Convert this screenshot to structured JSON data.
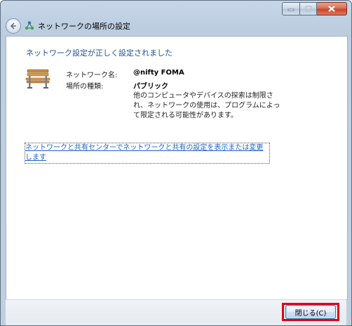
{
  "window": {
    "title": "ネットワークの場所の設定",
    "icons": {
      "back": "back-arrow-icon",
      "network": "network-icon",
      "minimize": "minimize-icon",
      "maximize": "maximize-icon",
      "close": "close-icon"
    }
  },
  "main": {
    "heading": "ネットワーク設定が正しく設定されました",
    "network_name_label": "ネットワーク名:",
    "network_name_value": "@nifty FOMA",
    "location_type_label": "場所の種類:",
    "location_type_value": "パブリック",
    "description": "他のコンピュータやデバイスの探索は制限され、ネットワークの使用は、プログラムによって限定される可能性があります。",
    "link_text": "ネットワークと共有センターでネットワークと共有の設定を表示または変更します",
    "icon": "park-bench-icon"
  },
  "footer": {
    "close_button_label": "閉じる(C)"
  },
  "colors": {
    "heading": "#1d4f9b",
    "link": "#1e63c8",
    "highlight": "#e3001a"
  }
}
